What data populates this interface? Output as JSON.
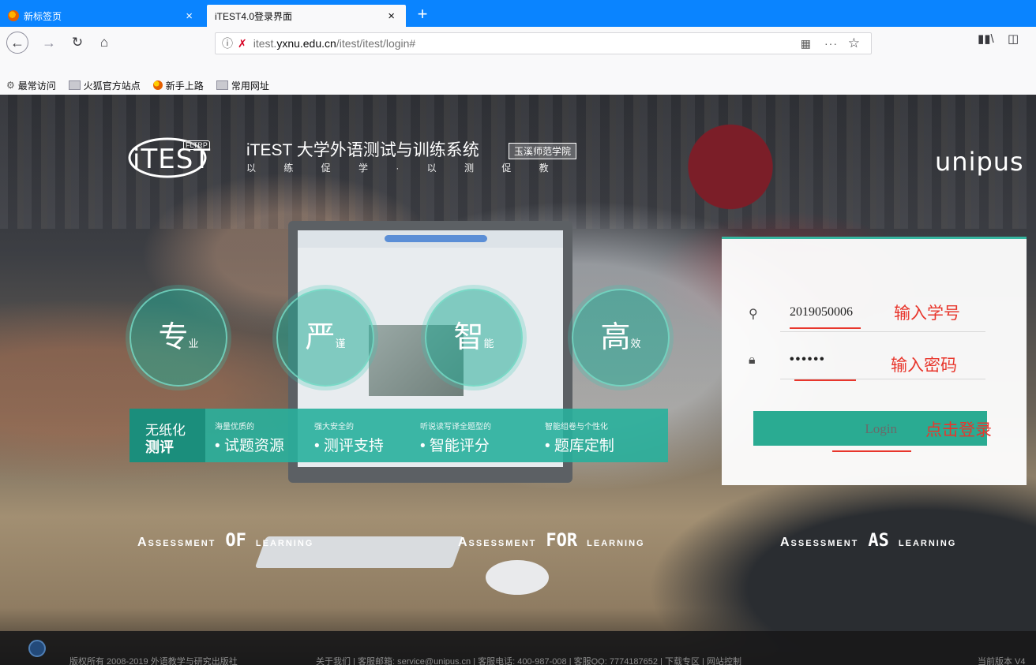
{
  "browser": {
    "tabs": [
      {
        "title": "新标签页",
        "active": false
      },
      {
        "title": "iTEST4.0登录界面",
        "active": true
      }
    ],
    "tab_close": "×",
    "new_tab": "+",
    "url_prefix": "itest.",
    "url_host": "yxnu.edu.cn",
    "url_path": "/itest/itest/login#",
    "url_more": "···",
    "bookmarks": [
      "最常访问",
      "火狐官方站点",
      "新手上路",
      "常用网址"
    ]
  },
  "page": {
    "brand": {
      "logo_text": "iTEST",
      "logo_tag": "FLTRP",
      "title": "iTEST 大学外语测试与训练系统",
      "badge": "玉溪师范学院",
      "motto": "以 练 促 学 · 以 测 促 教",
      "partner": "unipus"
    },
    "circles": [
      {
        "big": "专",
        "small": "业"
      },
      {
        "big": "严",
        "small": "谨"
      },
      {
        "big": "智",
        "small": "能"
      },
      {
        "big": "高",
        "small": "效"
      }
    ],
    "band": {
      "lead_1": "无纸化",
      "lead_2": "测评",
      "items": [
        {
          "sub": "海量优质的",
          "main": "• 试题资源"
        },
        {
          "sub": "强大安全的",
          "main": "• 测评支持"
        },
        {
          "sub": "听说读写译全题型的",
          "main": "• 智能评分"
        },
        {
          "sub": "智能组卷与个性化",
          "main": "• 题库定制"
        }
      ]
    },
    "assessments": [
      {
        "left": "Assessment",
        "mid": "OF",
        "right": "learning"
      },
      {
        "left": "Assessment",
        "mid": "FOR",
        "right": "learning"
      },
      {
        "left": "Assessment",
        "mid": "AS",
        "right": "learning"
      }
    ],
    "login": {
      "username": "2019050006",
      "password_mask": "••••••",
      "button": "Login",
      "annot_user": "输入学号",
      "annot_pass": "输入密码",
      "annot_login": "点击登录"
    },
    "footer": {
      "copyright": "版权所有 2008-2019 外语教学与研究出版社",
      "links": "关于我们 | 客服邮箱: service@unipus.cn | 客服电话: 400-987-008 | 客服QQ: 7774187652 | 下载专区 | 网站控制",
      "right": "当前版本 V4"
    }
  }
}
